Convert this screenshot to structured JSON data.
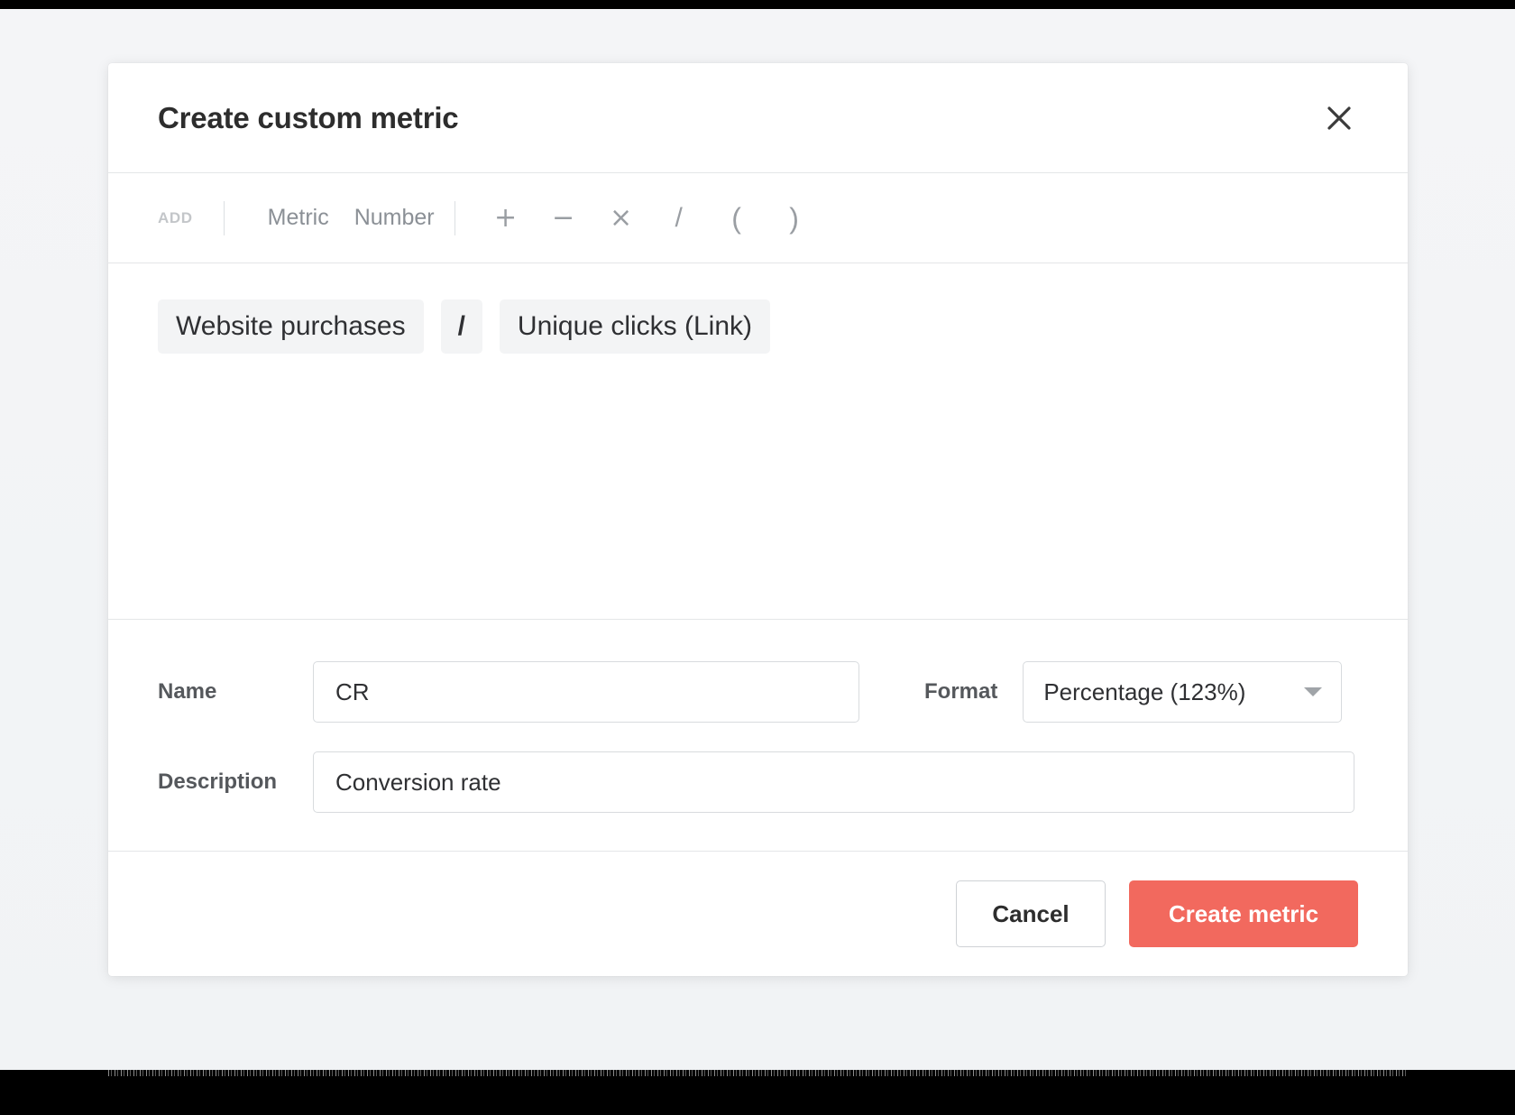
{
  "colors": {
    "page_background": "#f3f4f6",
    "modal_background": "#ffffff",
    "primary_button": "#f2695e",
    "chip_background": "#f3f4f5",
    "border": "#e4e6e8",
    "muted_text": "#8b9096"
  },
  "modal": {
    "title": "Create custom metric",
    "close_icon": "close-icon"
  },
  "toolbar": {
    "add_label": "ADD",
    "sources": [
      {
        "label": "Metric",
        "name": "metric"
      },
      {
        "label": "Number",
        "name": "number"
      }
    ],
    "operators": [
      {
        "glyph": "+",
        "name": "plus"
      },
      {
        "glyph": "−",
        "name": "minus"
      },
      {
        "glyph": "×",
        "name": "multiply"
      },
      {
        "glyph": "/",
        "name": "divide"
      },
      {
        "glyph": "(",
        "name": "open-paren"
      },
      {
        "glyph": ")",
        "name": "close-paren"
      }
    ]
  },
  "formula": {
    "tokens": [
      {
        "text": "Website purchases",
        "type": "metric"
      },
      {
        "text": "/",
        "type": "operator"
      },
      {
        "text": "Unique clicks (Link)",
        "type": "metric"
      }
    ]
  },
  "fields": {
    "name": {
      "label": "Name",
      "value": "CR",
      "placeholder": "Name"
    },
    "format": {
      "label": "Format",
      "value": "Percentage (123%)",
      "caret_icon": "chevron-down-icon"
    },
    "description": {
      "label": "Description",
      "value": "Conversion rate",
      "placeholder": "Description"
    }
  },
  "footer": {
    "cancel_label": "Cancel",
    "create_label": "Create metric"
  }
}
